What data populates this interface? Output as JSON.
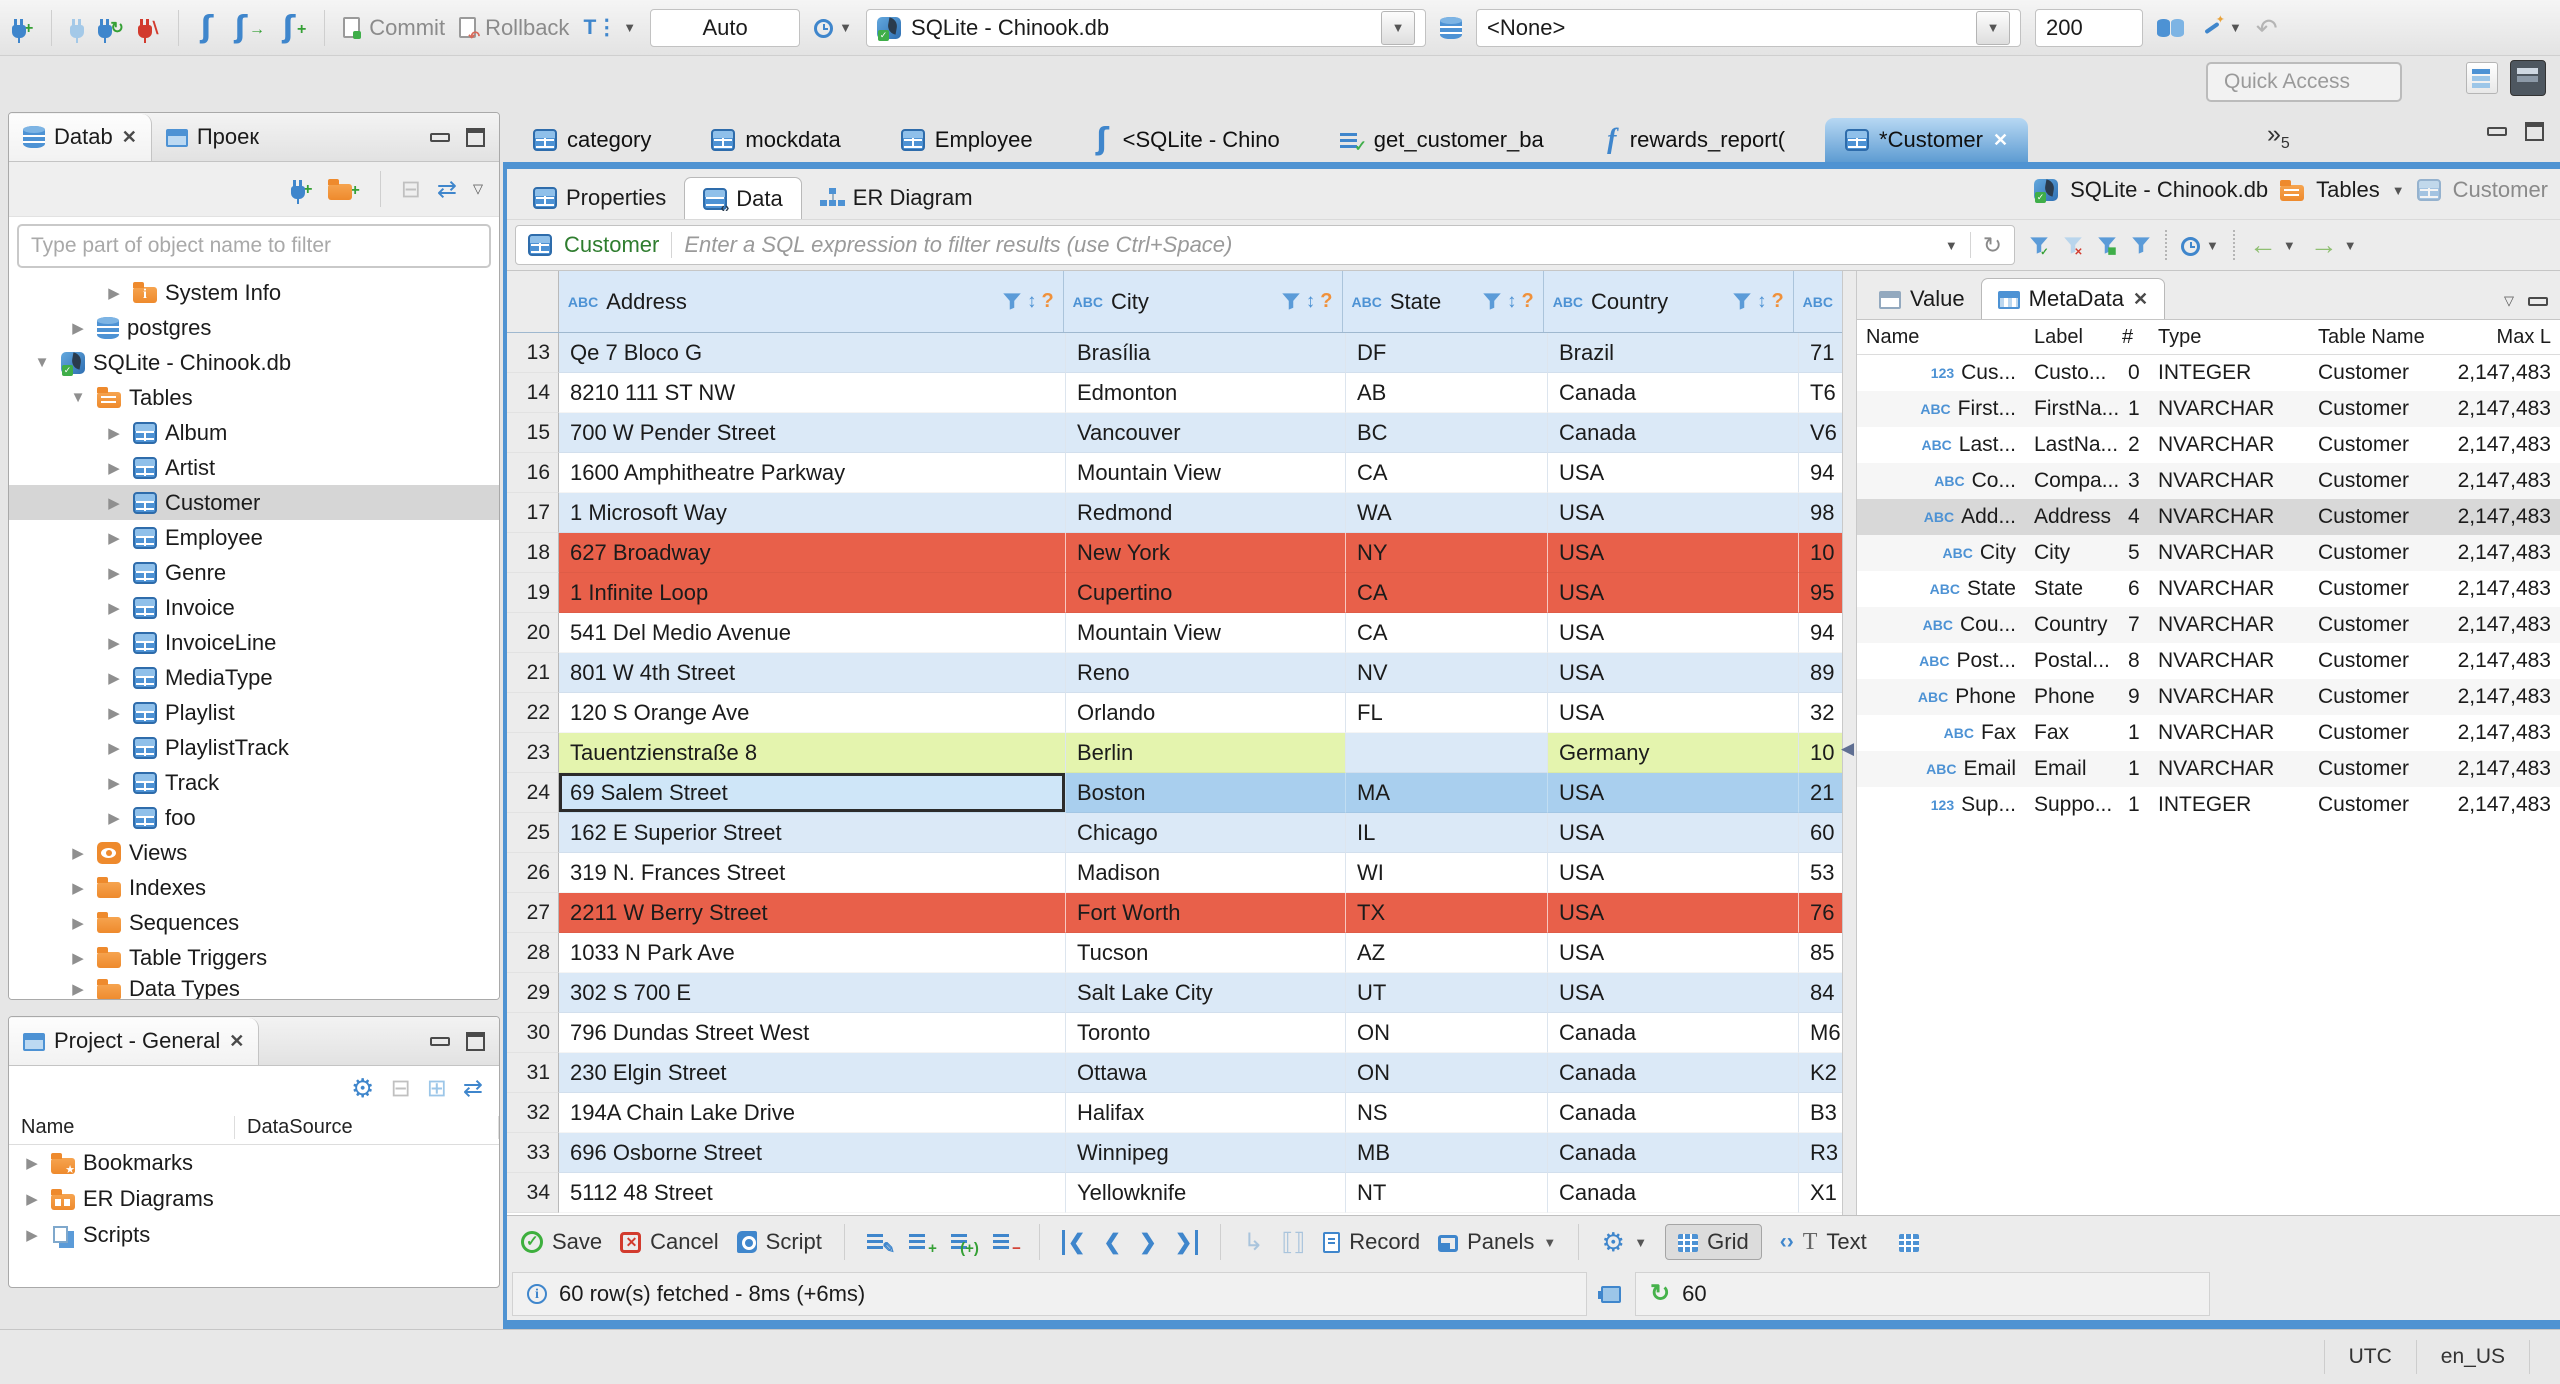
{
  "colors": {
    "accent": "#4f93d2",
    "row_error": "#e8604a",
    "row_highlight_green": "#e4f4ae",
    "row_selected": "#a9cfee",
    "grid_header_bg": "#d9e8f8"
  },
  "toolbar": {
    "commit": "Commit",
    "rollback": "Rollback",
    "auto": "Auto",
    "connection": "SQLite - Chinook.db",
    "schema": "<None>",
    "fetch_size": "200",
    "quick_access": "Quick Access"
  },
  "navigator": {
    "tab_db": "Datab",
    "tab_proj": "Проек",
    "filter_placeholder": "Type part of object name to filter",
    "tree": [
      {
        "cls": "lv2",
        "arrow": "▶",
        "icon": "ic-folder-info",
        "label": "System Info"
      },
      {
        "cls": "lv1",
        "arrow": "▶",
        "icon": "ic-db",
        "label": "postgres"
      },
      {
        "cls": "lv0",
        "arrow": "▼",
        "icon": "ic-sqlite",
        "label": "SQLite - Chinook.db"
      },
      {
        "cls": "lv1",
        "arrow": "▼",
        "icon": "ic-folder-table",
        "label": "Tables"
      },
      {
        "cls": "lv2",
        "arrow": "▶",
        "icon": "ic-table",
        "label": "Album"
      },
      {
        "cls": "lv2",
        "arrow": "▶",
        "icon": "ic-table",
        "label": "Artist"
      },
      {
        "cls": "lv2 sel",
        "arrow": "▶",
        "icon": "ic-table",
        "label": "Customer"
      },
      {
        "cls": "lv2",
        "arrow": "▶",
        "icon": "ic-table",
        "label": "Employee"
      },
      {
        "cls": "lv2",
        "arrow": "▶",
        "icon": "ic-table",
        "label": "Genre"
      },
      {
        "cls": "lv2",
        "arrow": "▶",
        "icon": "ic-table",
        "label": "Invoice"
      },
      {
        "cls": "lv2",
        "arrow": "▶",
        "icon": "ic-table",
        "label": "InvoiceLine"
      },
      {
        "cls": "lv2",
        "arrow": "▶",
        "icon": "ic-table",
        "label": "MediaType"
      },
      {
        "cls": "lv2",
        "arrow": "▶",
        "icon": "ic-table",
        "label": "Playlist"
      },
      {
        "cls": "lv2",
        "arrow": "▶",
        "icon": "ic-table",
        "label": "PlaylistTrack"
      },
      {
        "cls": "lv2",
        "arrow": "▶",
        "icon": "ic-table",
        "label": "Track"
      },
      {
        "cls": "lv2",
        "arrow": "▶",
        "icon": "ic-table",
        "label": "foo"
      },
      {
        "cls": "lv1",
        "arrow": "▶",
        "icon": "ic-eye",
        "label": "Views"
      },
      {
        "cls": "lv1",
        "arrow": "▶",
        "icon": "ic-folder",
        "label": "Indexes"
      },
      {
        "cls": "lv1",
        "arrow": "▶",
        "icon": "ic-folder",
        "label": "Sequences"
      },
      {
        "cls": "lv1",
        "arrow": "▶",
        "icon": "ic-folder",
        "label": "Table Triggers"
      },
      {
        "cls": "lv1 clip",
        "arrow": "▶",
        "icon": "ic-folder",
        "label": "Data Types"
      }
    ]
  },
  "project": {
    "title": "Project - General",
    "col_name": "Name",
    "col_datasource": "DataSource",
    "items": [
      {
        "arrow": "▶",
        "icon": "ic-folder-star",
        "label": "Bookmarks"
      },
      {
        "arrow": "▶",
        "icon": "ic-folder-er",
        "label": "ER Diagrams"
      },
      {
        "arrow": "▶",
        "icon": "ic-scripts",
        "label": "Scripts"
      }
    ]
  },
  "editor": {
    "tabs": [
      {
        "cls": "",
        "icon": "ic-table",
        "label": "category",
        "close": ""
      },
      {
        "cls": "",
        "icon": "ic-table",
        "label": "mockdata",
        "close": ""
      },
      {
        "cls": "",
        "icon": "ic-table",
        "label": "Employee",
        "close": ""
      },
      {
        "cls": "",
        "icon": "ic-scroll",
        "label": "<SQLite - Chino",
        "close": ""
      },
      {
        "cls": "",
        "icon": "ic-sqlfile",
        "label": "get_customer_ba",
        "close": ""
      },
      {
        "cls": "",
        "icon": "ic-f",
        "label": "rewards_report(",
        "close": ""
      },
      {
        "cls": "active",
        "icon": "ic-table",
        "label": "*Customer",
        "close": "✕"
      }
    ],
    "overflow_chevron": "»",
    "overflow_count": "5",
    "result_tabs": [
      {
        "cls": "",
        "icon": "ic-table",
        "label": "Properties"
      },
      {
        "cls": "active",
        "icon": "ic-data",
        "label": "Data"
      },
      {
        "cls": "",
        "icon": "ic-er",
        "label": "ER Diagram"
      }
    ],
    "breadcrumb": {
      "db": "SQLite - Chinook.db",
      "group": "Tables",
      "table": "Customer"
    },
    "filter": {
      "entity": "Customer",
      "placeholder": "Enter a SQL expression to filter results (use Ctrl+Space)"
    },
    "grid": {
      "header": {
        "c1": "Address",
        "c2": "City",
        "c3": "State",
        "c4": "Country"
      },
      "rows": [
        {
          "cls": "alt",
          "n": "13",
          "address": "Qe 7 Bloco G",
          "city": "Brasília",
          "state": "DF",
          "country": "Brazil",
          "postal": "71"
        },
        {
          "cls": "",
          "n": "14",
          "address": "8210 111 ST NW",
          "city": "Edmonton",
          "state": "AB",
          "country": "Canada",
          "postal": "T6"
        },
        {
          "cls": "alt",
          "n": "15",
          "address": "700 W Pender Street",
          "city": "Vancouver",
          "state": "BC",
          "country": "Canada",
          "postal": "V6"
        },
        {
          "cls": "",
          "n": "16",
          "address": "1600 Amphitheatre Parkway",
          "city": "Mountain View",
          "state": "CA",
          "country": "USA",
          "postal": "94"
        },
        {
          "cls": "alt",
          "n": "17",
          "address": "1 Microsoft Way",
          "city": "Redmond",
          "state": "WA",
          "country": "USA",
          "postal": "98"
        },
        {
          "cls": "red",
          "n": "18",
          "address": "627 Broadway",
          "city": "New York",
          "state": "NY",
          "country": "USA",
          "postal": "10"
        },
        {
          "cls": "red",
          "n": "19",
          "address": "1 Infinite Loop",
          "city": "Cupertino",
          "state": "CA",
          "country": "USA",
          "postal": "95"
        },
        {
          "cls": "",
          "n": "20",
          "address": "541 Del Medio Avenue",
          "city": "Mountain View",
          "state": "CA",
          "country": "USA",
          "postal": "94"
        },
        {
          "cls": "alt",
          "n": "21",
          "address": "801 W 4th Street",
          "city": "Reno",
          "state": "NV",
          "country": "USA",
          "postal": "89"
        },
        {
          "cls": "",
          "n": "22",
          "address": "120 S Orange Ave",
          "city": "Orlando",
          "state": "FL",
          "country": "USA",
          "postal": "32"
        },
        {
          "cls": "green",
          "n": "23",
          "address": "Tauentzienstraße 8",
          "city": "Berlin",
          "state": "",
          "country": "Germany",
          "postal": "10",
          "sc": "altcell"
        },
        {
          "cls": "sel",
          "n": "24",
          "address": "69 Salem Street",
          "city": "Boston",
          "state": "MA",
          "country": "USA",
          "postal": "21",
          "ac": "focus"
        },
        {
          "cls": "alt",
          "n": "25",
          "address": "162 E Superior Street",
          "city": "Chicago",
          "state": "IL",
          "country": "USA",
          "postal": "60"
        },
        {
          "cls": "",
          "n": "26",
          "address": "319 N. Frances Street",
          "city": "Madison",
          "state": "WI",
          "country": "USA",
          "postal": "53"
        },
        {
          "cls": "red",
          "n": "27",
          "address": "2211 W Berry Street",
          "city": "Fort Worth",
          "state": "TX",
          "country": "USA",
          "postal": "76"
        },
        {
          "cls": "",
          "n": "28",
          "address": "1033 N Park Ave",
          "city": "Tucson",
          "state": "AZ",
          "country": "USA",
          "postal": "85"
        },
        {
          "cls": "alt",
          "n": "29",
          "address": "302 S 700 E",
          "city": "Salt Lake City",
          "state": "UT",
          "country": "USA",
          "postal": "84"
        },
        {
          "cls": "",
          "n": "30",
          "address": "796 Dundas Street West",
          "city": "Toronto",
          "state": "ON",
          "country": "Canada",
          "postal": "M6"
        },
        {
          "cls": "alt",
          "n": "31",
          "address": "230 Elgin Street",
          "city": "Ottawa",
          "state": "ON",
          "country": "Canada",
          "postal": "K2"
        },
        {
          "cls": "",
          "n": "32",
          "address": "194A Chain Lake Drive",
          "city": "Halifax",
          "state": "NS",
          "country": "Canada",
          "postal": "B3"
        },
        {
          "cls": "alt",
          "n": "33",
          "address": "696 Osborne Street",
          "city": "Winnipeg",
          "state": "MB",
          "country": "Canada",
          "postal": "R3"
        },
        {
          "cls": "",
          "n": "34",
          "address": "5112 48 Street",
          "city": "Yellowknife",
          "state": "NT",
          "country": "Canada",
          "postal": "X1"
        }
      ]
    },
    "meta": {
      "tab_value": "Value",
      "tab_metadata": "MetaData",
      "columns": {
        "name": "Name",
        "label": "Label",
        "num": "#",
        "type": "Type",
        "table": "Table Name",
        "max": "Max L"
      },
      "rows": [
        {
          "cls": "",
          "t": "123",
          "name": "Cus...",
          "label": "Custo...",
          "num": "0",
          "type": "INTEGER",
          "table": "Customer",
          "max": "2,147,483"
        },
        {
          "cls": "",
          "t": "ABC",
          "name": "First...",
          "label": "FirstNa...",
          "num": "1",
          "type": "NVARCHAR",
          "table": "Customer",
          "max": "2,147,483"
        },
        {
          "cls": "",
          "t": "ABC",
          "name": "Last...",
          "label": "LastNa...",
          "num": "2",
          "type": "NVARCHAR",
          "table": "Customer",
          "max": "2,147,483"
        },
        {
          "cls": "",
          "t": "ABC",
          "name": "Co...",
          "label": "Compa...",
          "num": "3",
          "type": "NVARCHAR",
          "table": "Customer",
          "max": "2,147,483"
        },
        {
          "cls": "msel",
          "t": "ABC",
          "name": "Add...",
          "label": "Address",
          "num": "4",
          "type": "NVARCHAR",
          "table": "Customer",
          "max": "2,147,483"
        },
        {
          "cls": "",
          "t": "ABC",
          "name": "City",
          "label": "City",
          "num": "5",
          "type": "NVARCHAR",
          "table": "Customer",
          "max": "2,147,483"
        },
        {
          "cls": "",
          "t": "ABC",
          "name": "State",
          "label": "State",
          "num": "6",
          "type": "NVARCHAR",
          "table": "Customer",
          "max": "2,147,483"
        },
        {
          "cls": "",
          "t": "ABC",
          "name": "Cou...",
          "label": "Country",
          "num": "7",
          "type": "NVARCHAR",
          "table": "Customer",
          "max": "2,147,483"
        },
        {
          "cls": "",
          "t": "ABC",
          "name": "Post...",
          "label": "Postal...",
          "num": "8",
          "type": "NVARCHAR",
          "table": "Customer",
          "max": "2,147,483"
        },
        {
          "cls": "",
          "t": "ABC",
          "name": "Phone",
          "label": "Phone",
          "num": "9",
          "type": "NVARCHAR",
          "table": "Customer",
          "max": "2,147,483"
        },
        {
          "cls": "",
          "t": "ABC",
          "name": "Fax",
          "label": "Fax",
          "num": "1",
          "type": "NVARCHAR",
          "table": "Customer",
          "max": "2,147,483"
        },
        {
          "cls": "",
          "t": "ABC",
          "name": "Email",
          "label": "Email",
          "num": "1",
          "type": "NVARCHAR",
          "table": "Customer",
          "max": "2,147,483"
        },
        {
          "cls": "",
          "t": "123",
          "name": "Sup...",
          "label": "Suppo...",
          "num": "1",
          "type": "INTEGER",
          "table": "Customer",
          "max": "2,147,483"
        }
      ]
    },
    "actions": {
      "save": "Save",
      "cancel": "Cancel",
      "script": "Script",
      "record": "Record",
      "panels": "Panels",
      "grid": "Grid",
      "text": "Text"
    },
    "status": {
      "message": "60 row(s) fetched - 8ms (+6ms)",
      "refresh_value": "60"
    }
  },
  "statusbar": {
    "tz": "UTC",
    "locale": "en_US"
  }
}
